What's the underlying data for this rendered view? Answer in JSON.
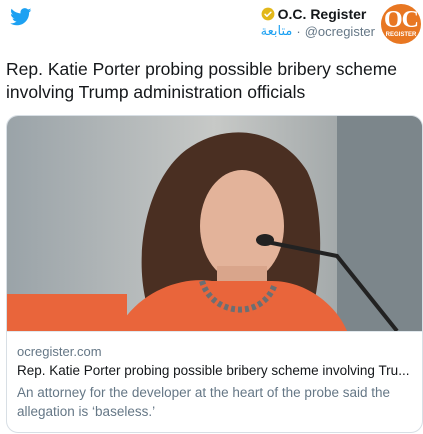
{
  "account": {
    "display_name": "O.C. Register",
    "handle": "@ocregister",
    "separator": "·",
    "follow_label": "متابعة",
    "avatar_text": "OC",
    "avatar_subtext": "REGISTER",
    "verified": true
  },
  "tweet": {
    "text": "Rep. Katie Porter probing possible bribery scheme involving Trump administration officials"
  },
  "card": {
    "domain": "ocregister.com",
    "title": "Rep. Katie Porter probing possible bribery scheme involving Tru...",
    "description": "An attorney for the developer at the heart of the probe said the allegation is ‘baseless.’"
  },
  "colors": {
    "twitter_blue": "#1da1f2",
    "avatar_orange": "#e87722",
    "verified_gold": "#e2b719",
    "muted_text": "#657786"
  }
}
